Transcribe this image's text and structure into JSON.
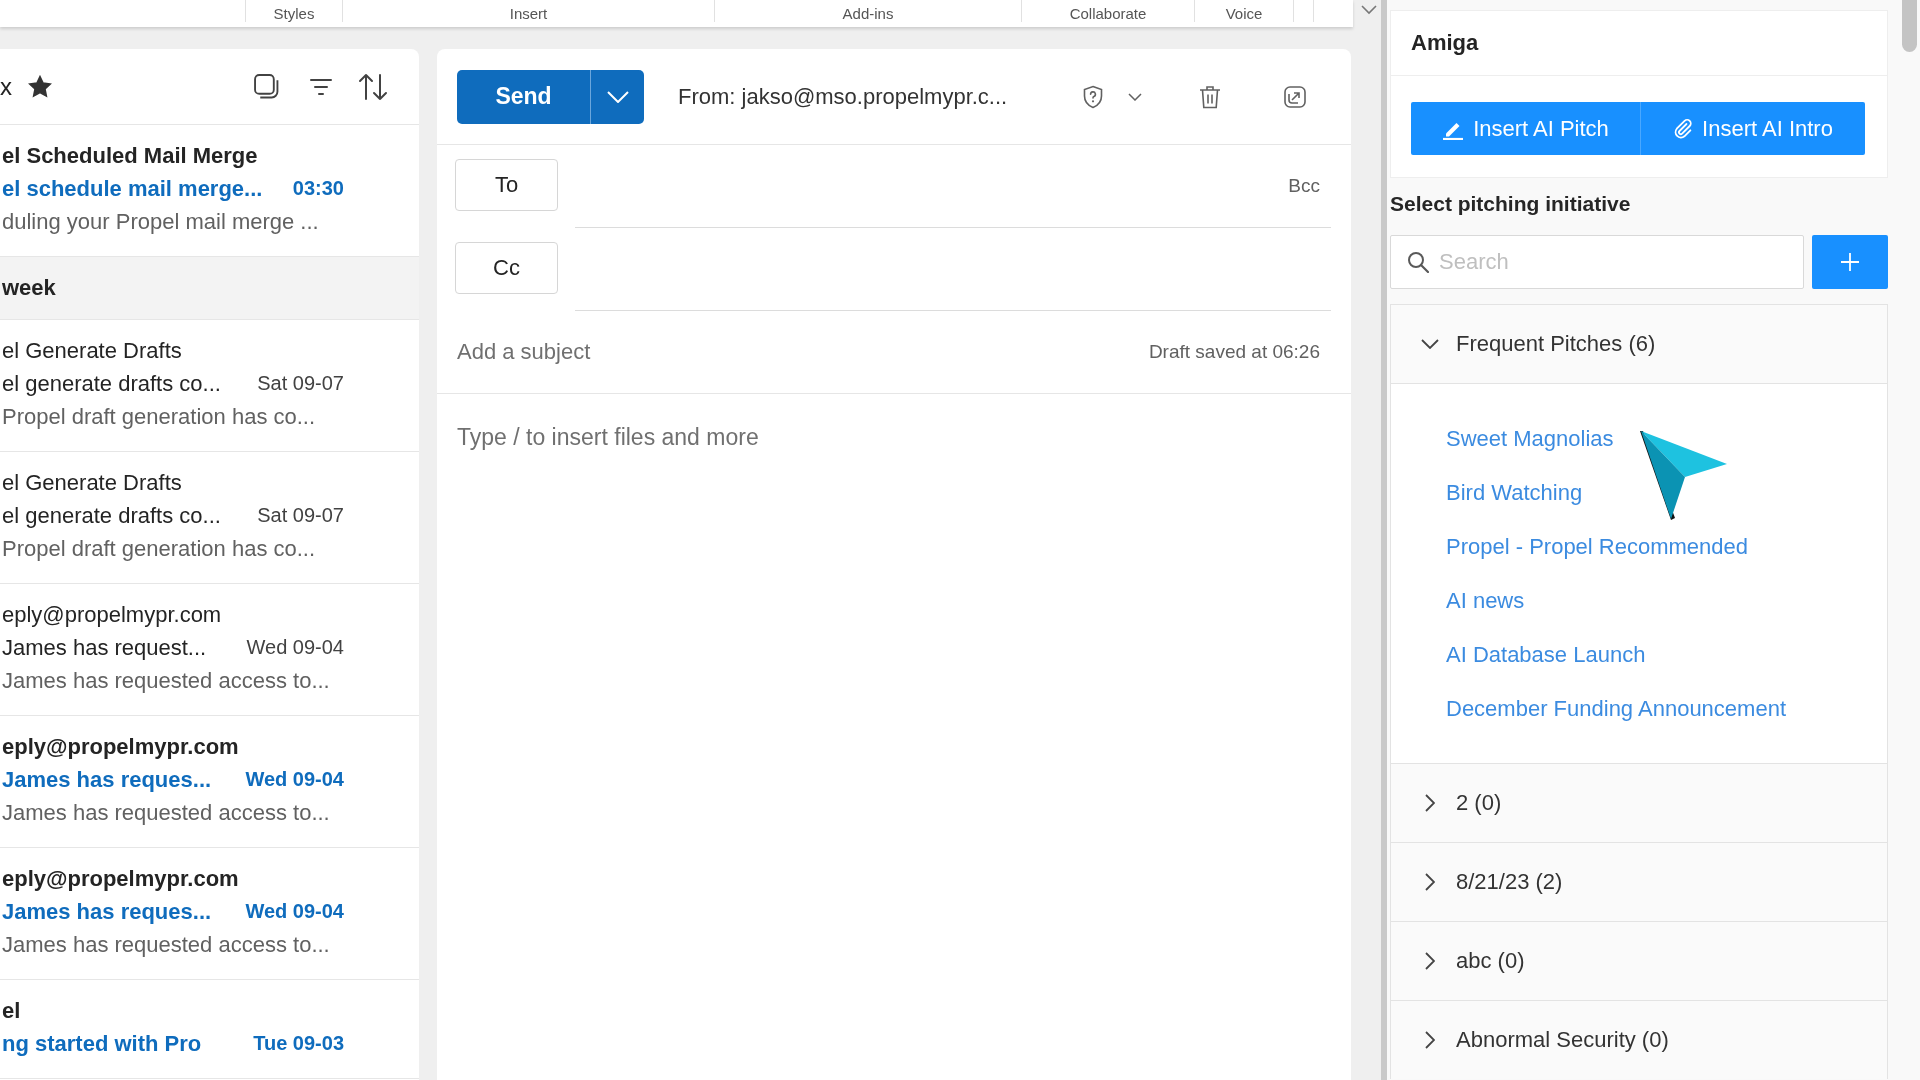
{
  "ribbon": {
    "groups": [
      "Styles",
      "Insert",
      "Add-ins",
      "Collaborate",
      "Voice"
    ]
  },
  "mail_list": {
    "folder_title": "x",
    "favorite": true,
    "items": [
      {
        "kind": "message",
        "sender": "el Scheduled Mail Merge",
        "subject": "el schedule mail merge...",
        "time": "03:30",
        "preview": "duling your Propel mail merge ...",
        "unread": true
      },
      {
        "kind": "group",
        "label": "week"
      },
      {
        "kind": "message",
        "sender": "el Generate Drafts",
        "subject": "el generate drafts co...",
        "time": "Sat 09-07",
        "preview": "Propel draft generation has co...",
        "unread": false
      },
      {
        "kind": "message",
        "sender": "el Generate Drafts",
        "subject": "el generate drafts co...",
        "time": "Sat 09-07",
        "preview": "Propel draft generation has co...",
        "unread": false
      },
      {
        "kind": "message",
        "sender": "eply@propelmypr.com",
        "subject": "James has request...",
        "time": "Wed 09-04",
        "preview": "James has requested access to...",
        "unread": false
      },
      {
        "kind": "message",
        "sender": "eply@propelmypr.com",
        "subject": "James has reques...",
        "time": "Wed 09-04",
        "preview": "James has requested access to...",
        "unread": true
      },
      {
        "kind": "message",
        "sender": "eply@propelmypr.com",
        "subject": "James has reques...",
        "time": "Wed 09-04",
        "preview": "James has requested access to...",
        "unread": true
      },
      {
        "kind": "message",
        "sender": "el",
        "subject": "ng started with Pro",
        "time": "Tue 09-03",
        "unread": true
      }
    ]
  },
  "compose": {
    "send": "Send",
    "from": "From: jakso@mso.propelmypr.c...",
    "recipients": [
      {
        "label": "To",
        "bcc": "Bcc"
      },
      {
        "label": "Cc"
      }
    ],
    "subject": {
      "placeholder": "Add a subject"
    },
    "draft_status": "Draft saved at 06:26",
    "body": {
      "placeholder": "Type / to insert files and more"
    }
  },
  "pitch_panel": {
    "title": "Amiga",
    "actions": [
      {
        "kind": "pitch",
        "label": "Insert AI Pitch"
      },
      {
        "kind": "intro",
        "label": "Insert AI Intro"
      }
    ],
    "section_title": "Select pitching initiative",
    "search": {
      "placeholder": "Search"
    },
    "groups": [
      {
        "label": "Frequent Pitches (6)",
        "expanded": true,
        "children": [
          {
            "label": "Sweet Magnolias"
          },
          {
            "label": "Bird Watching"
          },
          {
            "label": "Propel - Propel Recommended"
          },
          {
            "label": "AI news"
          },
          {
            "label": "AI Database Launch"
          },
          {
            "label": "December Funding Announcement"
          }
        ]
      },
      {
        "label": "2 (0)",
        "expanded": false
      },
      {
        "label": "8/21/23 (2)",
        "expanded": false
      },
      {
        "label": "abc (0)",
        "expanded": false
      },
      {
        "label": "Abnormal Security (0)",
        "expanded": false
      }
    ]
  }
}
